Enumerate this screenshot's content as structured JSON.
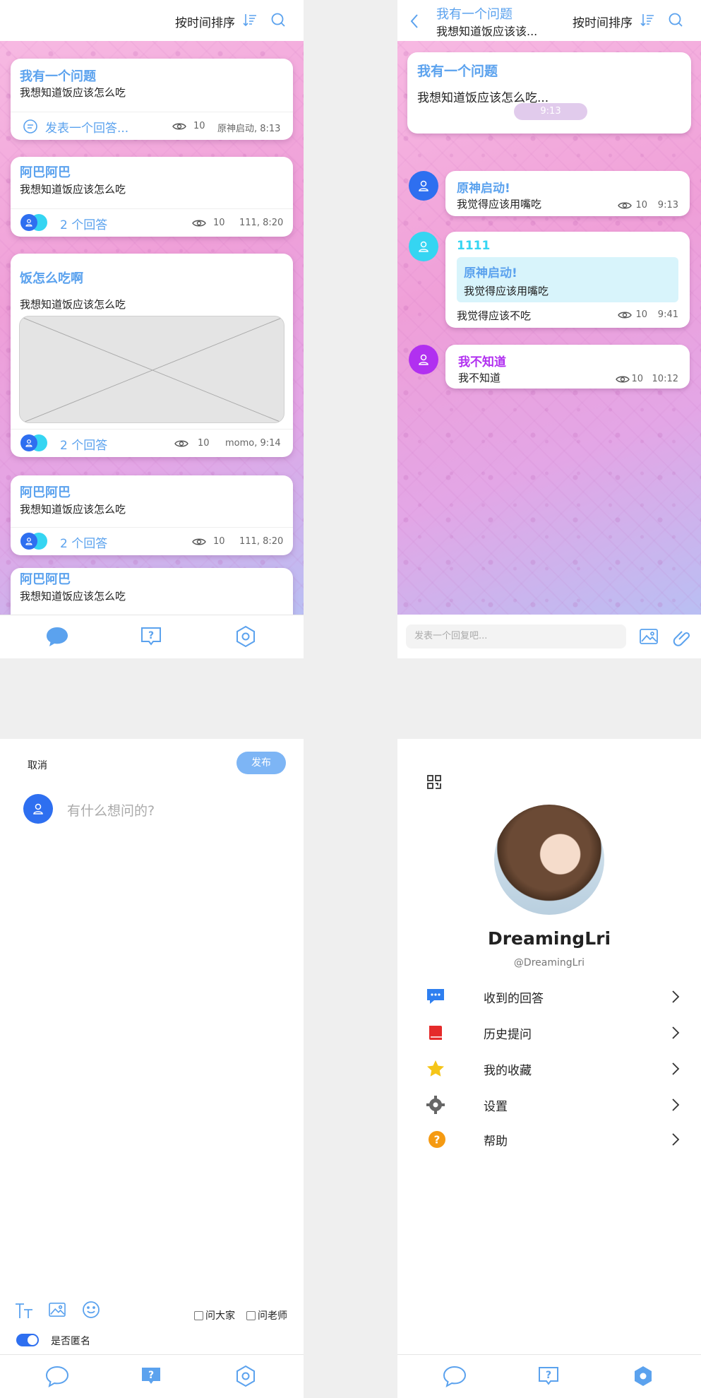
{
  "colors": {
    "accent": "#5ba2ee",
    "primary_blue": "#2e6ff0",
    "cyan": "#35d5f2",
    "purple": "#b130f0"
  },
  "feed": {
    "sort_label": "按时间排序",
    "posts": [
      {
        "title": "我有一个问题",
        "text": "我想知道饭应该怎么吃",
        "reply_prompt": "发表一个回答...",
        "views": "10",
        "meta": "原神启动, 8:13"
      },
      {
        "title": "阿巴阿巴",
        "text": "我想知道饭应该怎么吃",
        "answers": "2 个回答",
        "views": "10",
        "meta": "111, 8:20"
      },
      {
        "title": "饭怎么吃啊",
        "text": "我想知道饭应该怎么吃",
        "answers": "2 个回答",
        "views": "10",
        "meta": "momo, 9:14"
      },
      {
        "title": "阿巴阿巴",
        "text": "我想知道饭应该怎么吃",
        "answers": "2 个回答",
        "views": "10",
        "meta": "111, 8:20"
      },
      {
        "title": "阿巴阿巴",
        "text": "我想知道饭应该怎么吃"
      }
    ]
  },
  "chat": {
    "title": "我有一个问题",
    "subtitle": "我想知道饭应该该...",
    "sort_label": "按时间排序",
    "question_title": "我有一个问题",
    "question_text": "我想知道饭应该怎么吃...",
    "time_divider": "9:13",
    "messages": [
      {
        "name": "原神启动!",
        "text": "我觉得应该用嘴吃",
        "views": "10",
        "time": "9:13"
      },
      {
        "name": "1111",
        "quote_name": "原神启动!",
        "quote_text": "我觉得应该用嘴吃",
        "text": "我觉得应该不吃",
        "views": "10",
        "time": "9:41"
      },
      {
        "name": "我不知道",
        "text": "我不知道",
        "views": "10",
        "time": "10:12"
      }
    ],
    "reply_placeholder": "发表一个回复吧..."
  },
  "compose": {
    "cancel_label": "取消",
    "publish_label": "发布",
    "placeholder": "有什么想问的?",
    "ask_all": "问大家",
    "ask_teacher": "问老师",
    "anonymous_label": "是否匿名",
    "anonymous_on": true
  },
  "profile": {
    "name": "DreamingLri",
    "handle": "@DreamingLri",
    "menu": [
      {
        "label": "收到的回答",
        "icon": "chat-dots-icon"
      },
      {
        "label": "历史提问",
        "icon": "book-icon"
      },
      {
        "label": "我的收藏",
        "icon": "star-icon"
      },
      {
        "label": "设置",
        "icon": "gear-icon"
      },
      {
        "label": "帮助",
        "icon": "help-icon"
      }
    ]
  }
}
